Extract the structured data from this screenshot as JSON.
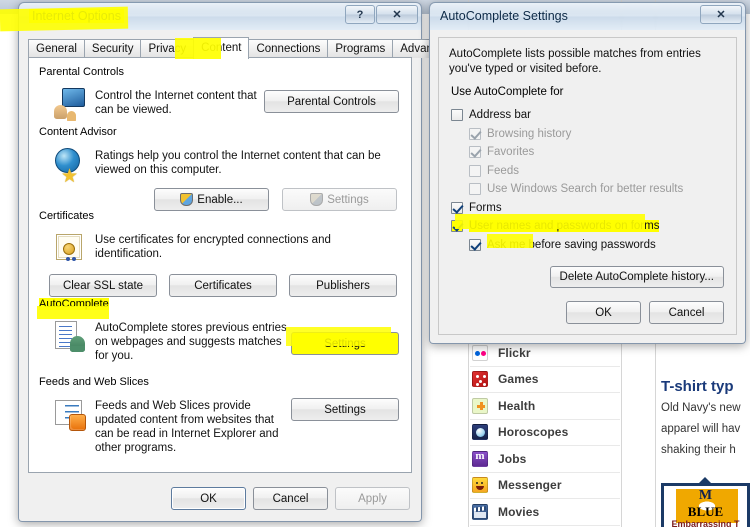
{
  "background": {
    "nav_items": [
      {
        "label": "Flickr",
        "icon": "flickr-icon"
      },
      {
        "label": "Games",
        "icon": "games-dice-icon"
      },
      {
        "label": "Health",
        "icon": "health-cross-icon"
      },
      {
        "label": "Horoscopes",
        "icon": "horoscopes-crystalball-icon"
      },
      {
        "label": "Jobs",
        "icon": "jobs-monster-icon"
      },
      {
        "label": "Messenger",
        "icon": "messenger-smiley-icon"
      },
      {
        "label": "Movies",
        "icon": "movies-clapper-icon"
      }
    ],
    "article": {
      "headline": "T-shirt typ",
      "body_lines": [
        "Old Navy's new",
        "apparel will hav",
        "shaking their h"
      ]
    },
    "ad": {
      "monogram": "M",
      "word": "BLUE",
      "caption": "Embarrassing T"
    }
  },
  "internet_options": {
    "title": "Internet Options",
    "title_highlighted": true,
    "window_buttons": {
      "help": "?",
      "close": "✕"
    },
    "tabs": [
      {
        "label": "General",
        "active": false,
        "highlighted": false
      },
      {
        "label": "Security",
        "active": false,
        "highlighted": false
      },
      {
        "label": "Privacy",
        "active": false,
        "highlighted": false
      },
      {
        "label": "Content",
        "active": true,
        "highlighted": true
      },
      {
        "label": "Connections",
        "active": false,
        "highlighted": false
      },
      {
        "label": "Programs",
        "active": false,
        "highlighted": false
      },
      {
        "label": "Advanced",
        "active": false,
        "highlighted": false
      }
    ],
    "groups": {
      "parental_controls": {
        "heading": "Parental Controls",
        "icon": "parental-controls-icon",
        "description": "Control the Internet content that can be viewed.",
        "button": "Parental Controls"
      },
      "content_advisor": {
        "heading": "Content Advisor",
        "icon": "content-advisor-globe-icon",
        "description": "Ratings help you control the Internet content that can be viewed on this computer.",
        "enable_button": "Enable...",
        "settings_button": "Settings",
        "settings_disabled": true
      },
      "certificates": {
        "heading": "Certificates",
        "icon": "certificate-icon",
        "description": "Use certificates for encrypted connections and identification.",
        "buttons": [
          "Clear SSL state",
          "Certificates",
          "Publishers"
        ]
      },
      "autocomplete": {
        "heading": "AutoComplete",
        "heading_highlighted": true,
        "icon": "autocomplete-icon",
        "description": "AutoComplete stores previous entries on webpages and suggests matches for you.",
        "settings_button": "Settings",
        "settings_highlighted": true
      },
      "feeds_web_slices": {
        "heading": "Feeds and Web Slices",
        "icon": "feeds-rss-icon",
        "description": "Feeds and Web Slices provide updated content from websites that can be read in Internet Explorer and other programs.",
        "settings_button": "Settings"
      }
    },
    "footer": {
      "ok": "OK",
      "cancel": "Cancel",
      "apply": "Apply",
      "apply_disabled": true
    }
  },
  "autocomplete_settings": {
    "title": "AutoComplete Settings",
    "window_buttons": {
      "close": "✕"
    },
    "intro": "AutoComplete lists possible matches from entries you've typed or visited before.",
    "group_heading": "Use AutoComplete for",
    "options": [
      {
        "label": "Address bar",
        "checked": false,
        "disabled": false,
        "indent": 0,
        "highlighted": false
      },
      {
        "label": "Browsing history",
        "checked": true,
        "disabled": true,
        "indent": 1,
        "highlighted": false
      },
      {
        "label": "Favorites",
        "checked": true,
        "disabled": true,
        "indent": 1,
        "highlighted": false
      },
      {
        "label": "Feeds",
        "checked": false,
        "disabled": true,
        "indent": 1,
        "highlighted": false
      },
      {
        "label": "Use Windows Search for better results",
        "checked": false,
        "disabled": true,
        "indent": 1,
        "highlighted": false
      },
      {
        "label": "Forms",
        "checked": true,
        "disabled": false,
        "indent": 0,
        "highlighted": false
      },
      {
        "label": "User names and passwords on forms",
        "checked": true,
        "disabled": false,
        "indent": 0,
        "highlighted": true
      },
      {
        "label": "Ask me before saving passwords",
        "checked": true,
        "disabled": false,
        "indent": 1,
        "highlighted": true
      }
    ],
    "delete_history_button": "Delete AutoComplete history...",
    "footer": {
      "ok": "OK",
      "cancel": "Cancel"
    }
  },
  "colors": {
    "highlight": "#ffff00",
    "window_body": "#f0f0f0",
    "pane": "#ffffff",
    "accent_blue": "#1a3a7a"
  }
}
